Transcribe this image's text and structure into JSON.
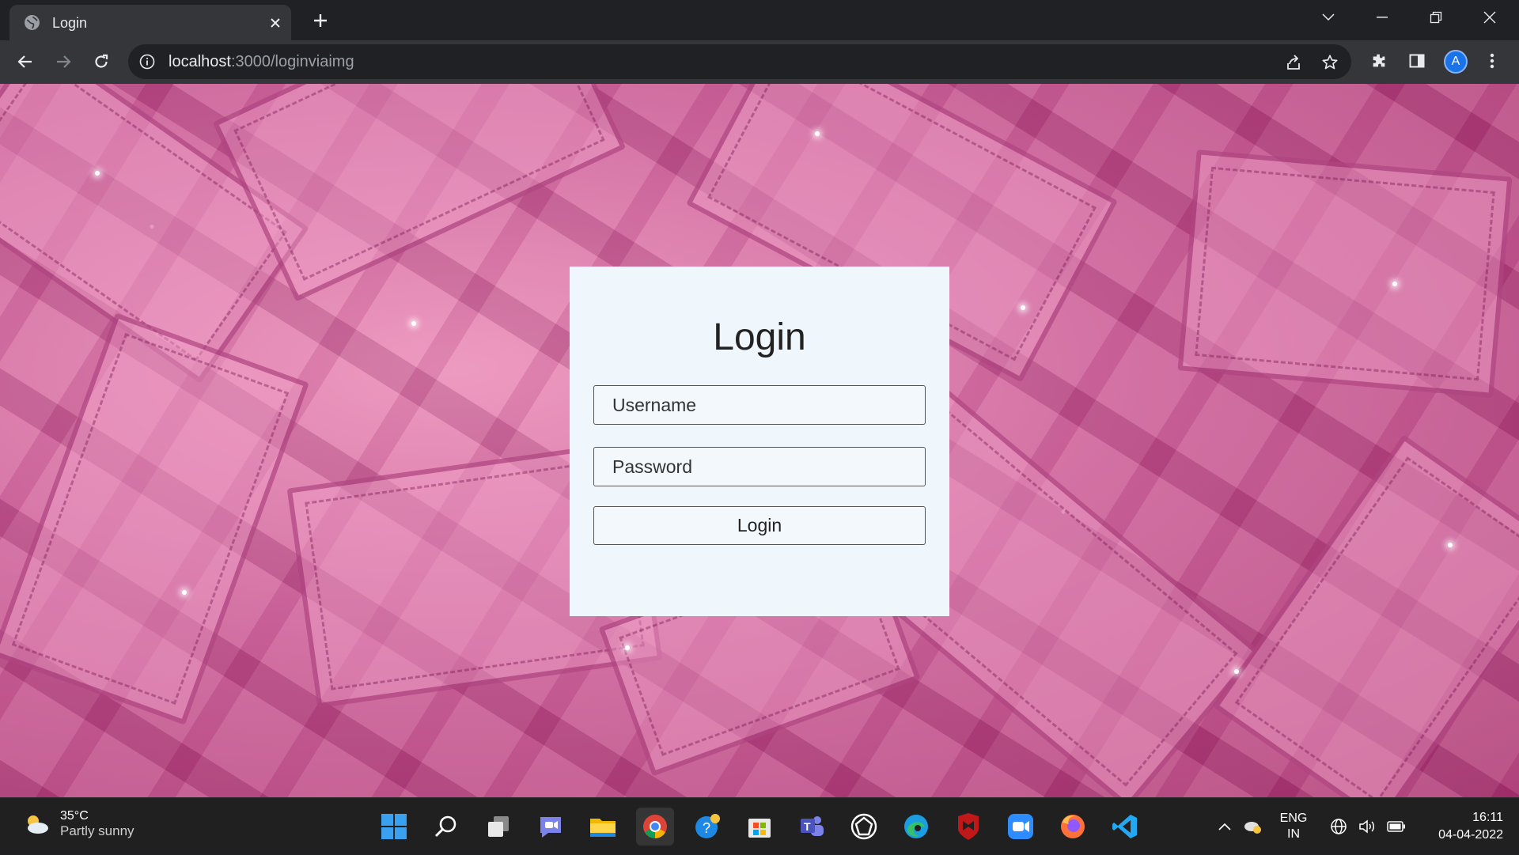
{
  "browser": {
    "tab_title": "Login",
    "url_host": "localhost",
    "url_rest": ":3000/loginviaimg",
    "profile_initial": "A"
  },
  "login": {
    "heading": "Login",
    "username_placeholder": "Username",
    "password_placeholder": "Password",
    "submit_label": "Login"
  },
  "taskbar": {
    "weather_temp": "35°C",
    "weather_desc": "Partly sunny",
    "apps": [
      "start-icon",
      "search-icon",
      "task-view-icon",
      "chat-icon",
      "file-explorer-icon",
      "chrome-icon",
      "quick-assist-icon",
      "store-icon",
      "teams-icon",
      "app-icon",
      "edge-icon",
      "mcafee-icon",
      "zoom-icon",
      "firefox-icon",
      "vscode-icon"
    ],
    "lang_line1": "ENG",
    "lang_line2": "IN",
    "time": "16:11",
    "date": "04-04-2022"
  },
  "colors": {
    "chrome_dark": "#202124",
    "chrome_toolbar": "#35363a",
    "card_bg": "#eff6fc",
    "taskbar_bg": "#202020",
    "accent": "#1a73e8"
  }
}
